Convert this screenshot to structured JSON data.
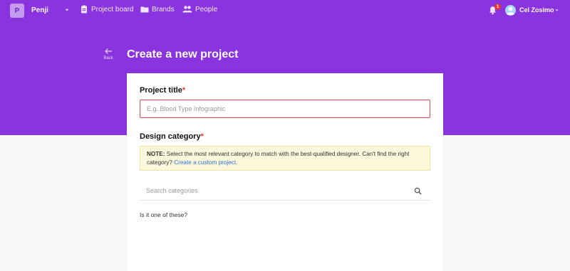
{
  "topbar": {
    "workspace_initial": "P",
    "workspace_name": "Penji",
    "nav": [
      {
        "label": "Project board",
        "icon": "clipboard-icon"
      },
      {
        "label": "Brands",
        "icon": "folder-icon"
      },
      {
        "label": "People",
        "icon": "people-icon"
      }
    ],
    "notification_count": "1",
    "user_name": "Cel Zosimo"
  },
  "header": {
    "back_label": "Back",
    "title": "Create a new project"
  },
  "form": {
    "project_title": {
      "label": "Project title",
      "required_mark": "*",
      "placeholder": "E.g. Blood Type Infographic",
      "value": ""
    },
    "design_category": {
      "label": "Design category",
      "required_mark": "*",
      "note_prefix": "NOTE:",
      "note_text": " Select the most relevant category to match with the best-qualified designer. Can't find the right category? ",
      "note_link": "Create a custom project.",
      "search_placeholder": "Search categories",
      "suggestion_label": "Is it one of these?"
    }
  },
  "colors": {
    "brand": "#8a34e0",
    "required": "#e53935",
    "link": "#2a6fd6",
    "note_bg": "#fcf8dc"
  }
}
